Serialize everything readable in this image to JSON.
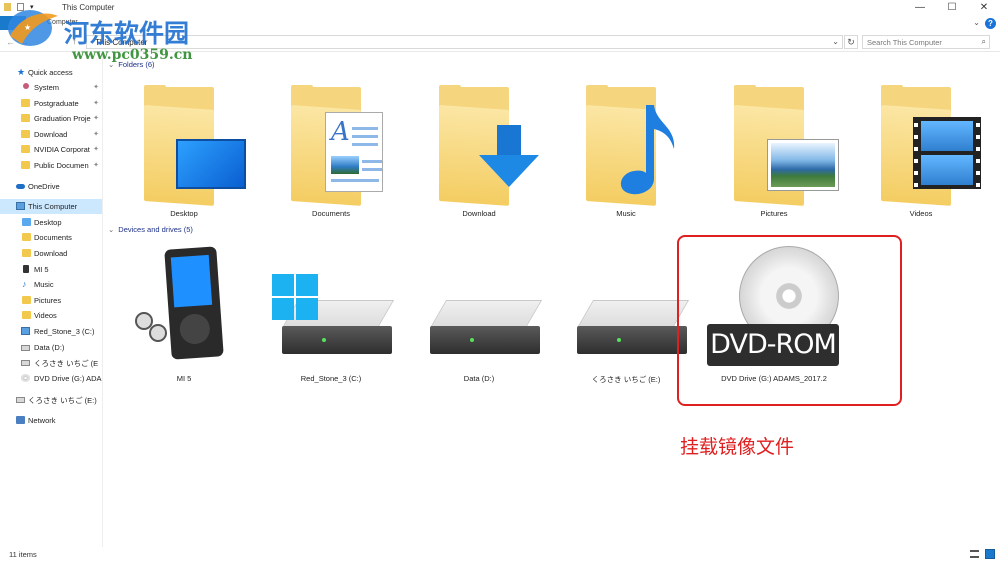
{
  "window": {
    "title": "This Computer",
    "controls": [
      "—",
      "☐",
      "✕"
    ]
  },
  "ribbon": {
    "tab_computer": "Computer",
    "help": "?",
    "toggle": "⌄"
  },
  "address": {
    "path": "This Computer",
    "search_placeholder": "Search This Computer",
    "refresh": "↻",
    "chevron": "⌄",
    "search_icon": "⌕"
  },
  "sidebar": {
    "items": [
      {
        "label": "Quick access",
        "icon": "star-icon"
      },
      {
        "label": "System",
        "icon": "system-icon",
        "pinned": true
      },
      {
        "label": "Postgraduate",
        "icon": "folder-icon",
        "pinned": true
      },
      {
        "label": "Graduation Proje",
        "icon": "folder-icon",
        "pinned": true
      },
      {
        "label": "Download",
        "icon": "folder-icon",
        "pinned": true
      },
      {
        "label": "NVIDIA Corporat",
        "icon": "folder-icon",
        "pinned": true
      },
      {
        "label": "Public Documen",
        "icon": "folder-icon",
        "pinned": true
      },
      {
        "label": "OneDrive",
        "icon": "cloud-icon"
      },
      {
        "label": "This Computer",
        "icon": "computer-icon"
      },
      {
        "label": "Desktop",
        "icon": "folder-icon"
      },
      {
        "label": "Documents",
        "icon": "folder-icon"
      },
      {
        "label": "Download",
        "icon": "folder-icon"
      },
      {
        "label": "MI 5",
        "icon": "phone-icon"
      },
      {
        "label": "Music",
        "icon": "music-icon"
      },
      {
        "label": "Pictures",
        "icon": "folder-icon"
      },
      {
        "label": "Videos",
        "icon": "folder-icon"
      },
      {
        "label": "Red_Stone_3 (C:)",
        "icon": "drive-icon"
      },
      {
        "label": "Data (D:)",
        "icon": "drive-icon"
      },
      {
        "label": "くろさき いちご (E",
        "icon": "drive-icon"
      },
      {
        "label": "DVD Drive (G:) ADA",
        "icon": "dvd-icon"
      },
      {
        "label": "くろさき いちご (E:)",
        "icon": "drive-icon"
      },
      {
        "label": "Network",
        "icon": "network-icon"
      }
    ],
    "pin_glyph": "📌",
    "selected": "This Computer"
  },
  "groups": {
    "folders": {
      "header": "Folders (6)",
      "items": [
        "Desktop",
        "Documents",
        "Download",
        "Music",
        "Pictures",
        "Videos"
      ]
    },
    "devices": {
      "header": "Devices and drives (5)",
      "items": [
        "MI 5",
        "Red_Stone_3 (C:)",
        "Data (D:)",
        "くろさき いちご (E:)",
        "DVD Drive (G:) ADAMS_2017.2"
      ]
    }
  },
  "dvd_label": "DVD-ROM",
  "annotation": "挂载镜像文件",
  "watermark": {
    "name": "河东软件园",
    "url": "www.pc0359.cn"
  },
  "status": {
    "items_count": "11 items"
  },
  "colors": {
    "accent": "#1979ca",
    "highlight": "#e02020",
    "selected_bg": "#cce8ff",
    "folder": "#f5d57e"
  }
}
